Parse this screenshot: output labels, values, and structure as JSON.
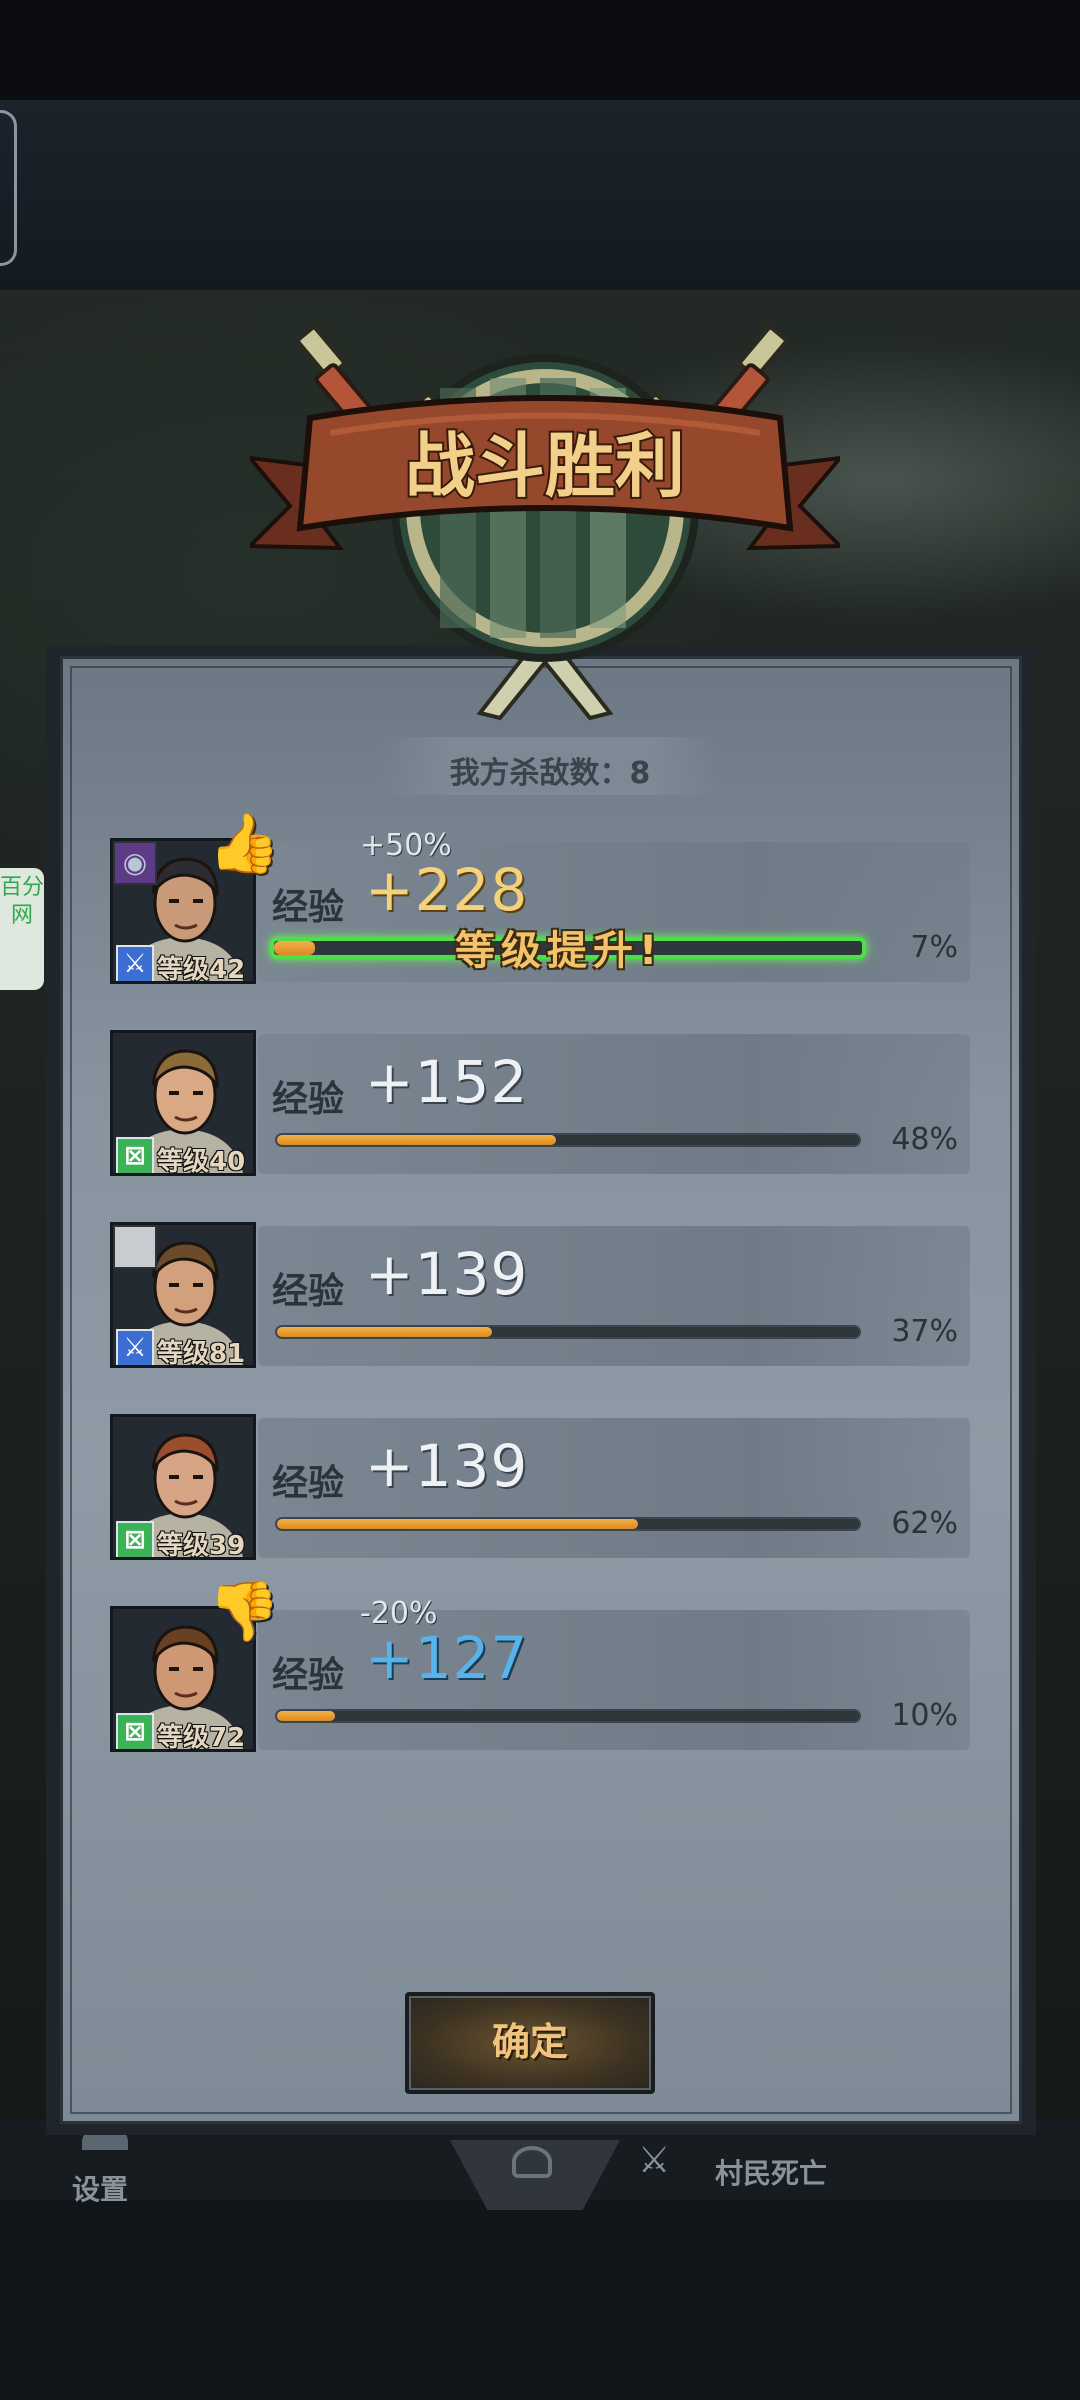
{
  "title": "战斗胜利",
  "kills": "我方杀敌数：8",
  "exp_label": "经验",
  "level_up_text": "等级提升!",
  "confirm_label": "确定",
  "side_tab": "百分网",
  "bottom_nav": {
    "settings": "设置",
    "villager_death": "村民死亡"
  },
  "heroes": [
    {
      "level": "等级42",
      "exp": "+228",
      "modifier": "+50%",
      "percent": "7%",
      "progress": 0.07,
      "class": "blue",
      "feedback": "thumbs-up",
      "level_up": true
    },
    {
      "level": "等级40",
      "exp": "+152",
      "modifier": "",
      "percent": "48%",
      "progress": 0.48,
      "class": "green",
      "feedback": "",
      "level_up": false
    },
    {
      "level": "等级81",
      "exp": "+139",
      "modifier": "",
      "percent": "37%",
      "progress": 0.37,
      "class": "blue",
      "feedback": "",
      "level_up": false
    },
    {
      "level": "等级39",
      "exp": "+139",
      "modifier": "",
      "percent": "62%",
      "progress": 0.62,
      "class": "green",
      "feedback": "",
      "level_up": false
    },
    {
      "level": "等级72",
      "exp": "+127",
      "modifier": "-20%",
      "percent": "10%",
      "progress": 0.1,
      "class": "green",
      "feedback": "thumbs-down",
      "level_up": false
    }
  ],
  "colors": {
    "exp_bar": "#e09a2e",
    "level_up_glow": "#4ee04a",
    "bonus_exp": "#f3d27a",
    "penalty_exp": "#57b3ea"
  }
}
